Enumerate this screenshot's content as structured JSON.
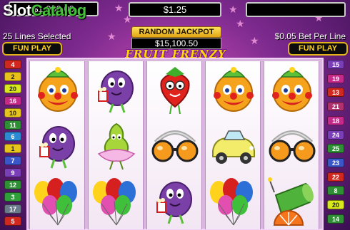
{
  "header": {
    "logo_slot": "Slot",
    "logo_catalog": "Catalog",
    "meter_left": "$1,000.00",
    "meter_center": "$1.25",
    "meter_right": ""
  },
  "lines_selected": "25 Lines Selected",
  "bet_per_line": "$0.05 Bet Per Line",
  "fun_play_left": "FUN PLAY",
  "fun_play_right": "FUN PLAY",
  "jackpot": {
    "title": "RANDOM JACKPOT",
    "value": "$15,100.50"
  },
  "game_title": "FRUIT FRENZY",
  "left_lines": [
    {
      "n": "4",
      "color": "#d0281f"
    },
    {
      "n": "2",
      "color": "#e8c21a"
    },
    {
      "n": "20",
      "color": "#d8e81a"
    },
    {
      "n": "16",
      "color": "#c52a8a"
    },
    {
      "n": "10",
      "color": "#e7c41c"
    },
    {
      "n": "11",
      "color": "#2f8f35"
    },
    {
      "n": "6",
      "color": "#2c8ad3"
    },
    {
      "n": "1",
      "color": "#e7c41c"
    },
    {
      "n": "7",
      "color": "#3a56c8"
    },
    {
      "n": "9",
      "color": "#7a3fb8"
    },
    {
      "n": "12",
      "color": "#2f8f35"
    },
    {
      "n": "3",
      "color": "#2f9f3a"
    },
    {
      "n": "17",
      "color": "#6a7a8a"
    },
    {
      "n": "5",
      "color": "#d0281f"
    }
  ],
  "right_lines": [
    {
      "n": "15",
      "color": "#7a3fb8"
    },
    {
      "n": "19",
      "color": "#c52a8a"
    },
    {
      "n": "13",
      "color": "#d0281f"
    },
    {
      "n": "21",
      "color": "#b03070"
    },
    {
      "n": "18",
      "color": "#c52a8a"
    },
    {
      "n": "24",
      "color": "#7a3fb8"
    },
    {
      "n": "25",
      "color": "#2f8f35"
    },
    {
      "n": "23",
      "color": "#3a56c8"
    },
    {
      "n": "22",
      "color": "#d0281f"
    },
    {
      "n": "8",
      "color": "#2f8f35"
    },
    {
      "n": "20",
      "color": "#d8e81a"
    },
    {
      "n": "14",
      "color": "#2f8f35"
    }
  ],
  "reels": [
    [
      "orange-clown",
      "plum-popcorn",
      "balloons"
    ],
    [
      "plum-popcorn",
      "pear-ballerina",
      "balloons"
    ],
    [
      "strawberry",
      "sunglasses",
      "plum-popcorn"
    ],
    [
      "orange-clown",
      "car",
      "balloons"
    ],
    [
      "orange-clown",
      "sunglasses",
      "watermelon-cannon"
    ]
  ],
  "colors": {
    "frame": "#d8b6dd",
    "fun_play": "#ffd21c",
    "jackpot_gold": "#e0a513"
  }
}
